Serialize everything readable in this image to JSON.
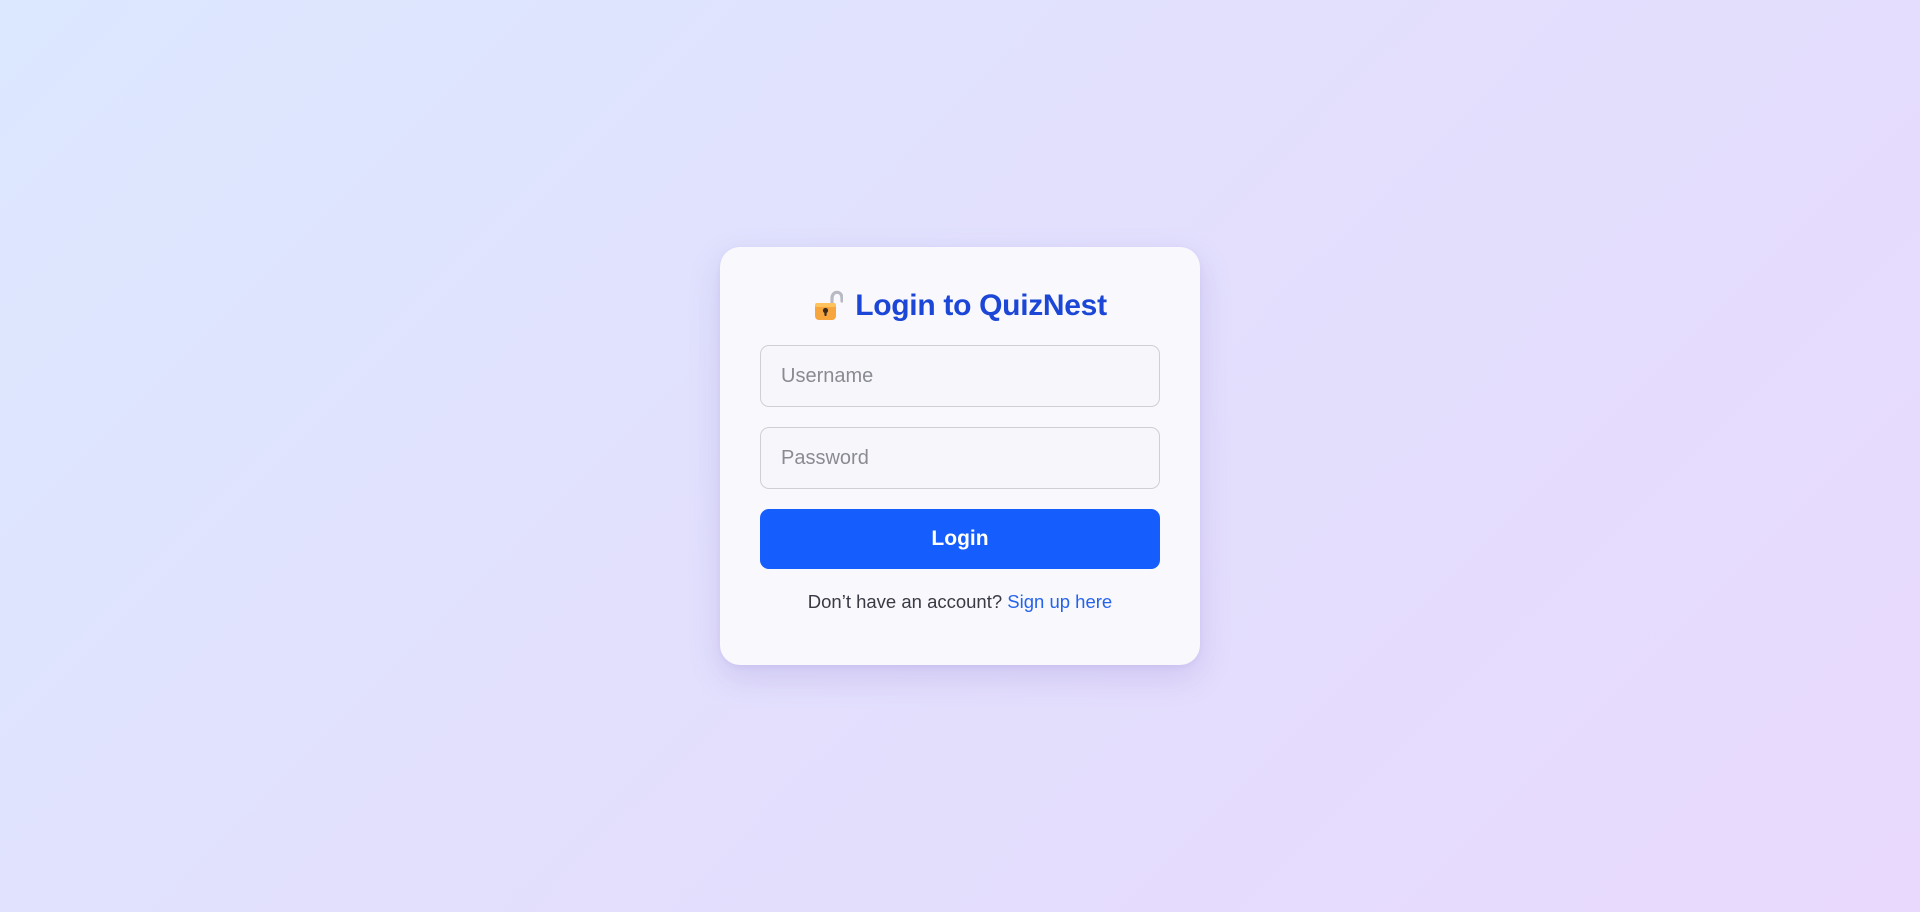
{
  "page": {
    "background_start": "#dce8ff",
    "background_end": "#e8d9fd"
  },
  "login_card": {
    "title_icon": "lock-icon",
    "title": "Login to QuizNest",
    "title_color": "#1c47d6",
    "username": {
      "value": "",
      "placeholder": "Username"
    },
    "password": {
      "value": "",
      "placeholder": "Password"
    },
    "login_button": {
      "label": "Login",
      "color": "#155dfc"
    },
    "signup_prompt": "Don’t have an account?",
    "signup_link": {
      "label": "Sign up here",
      "color": "#2563eb"
    }
  }
}
